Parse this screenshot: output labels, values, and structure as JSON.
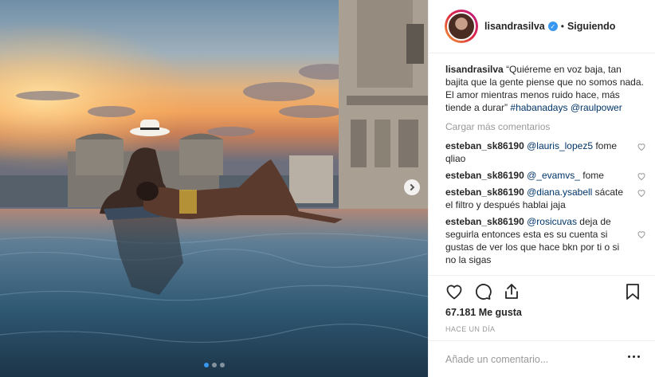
{
  "photo": {
    "slide_count": 3,
    "active_slide": 0,
    "next_icon": "chevron-right-icon"
  },
  "header": {
    "username": "lisandrasilva",
    "verified_icon": "verified-badge-icon",
    "separator": "•",
    "follow_status": "Siguiendo"
  },
  "caption": {
    "username": "lisandrasilva",
    "text": "“Quiéreme en voz baja, tan bajita que la gente piense que no somos nada. El amor mientras menos ruido hace, más tiende a durar”",
    "hashtag": "#habanadays",
    "mention": "@raulpower"
  },
  "load_more": "Cargar más comentarios",
  "comments": [
    {
      "username": "esteban_sk86190",
      "mention": "@lauris_lopez5",
      "text": " fome qliao"
    },
    {
      "username": "esteban_sk86190",
      "mention": "@_evamvs_",
      "text": " fome"
    },
    {
      "username": "esteban_sk86190",
      "mention": "@diana.ysabell",
      "text": " sácate el filtro y después hablai jaja"
    },
    {
      "username": "esteban_sk86190",
      "mention": "@rosicuvas",
      "text": " deja de seguirla entonces esta es su cuenta si gustas de ver los que hace bkn por ti o si no la sigas"
    }
  ],
  "actions": {
    "like_icon": "heart-icon",
    "comment_icon": "comment-icon",
    "share_icon": "share-icon",
    "save_icon": "bookmark-icon"
  },
  "likes": "67.181 Me gusta",
  "time_ago": "HACE UN DÍA",
  "add_comment": {
    "placeholder": "Añade un comentario...",
    "more_icon": "more-options-icon"
  },
  "colors": {
    "link": "#003569",
    "verified": "#3897f0",
    "muted": "#999999",
    "text": "#262626"
  }
}
